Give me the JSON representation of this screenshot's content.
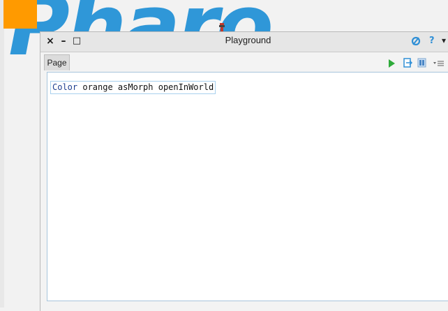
{
  "world": {
    "logo_text": "Pharo",
    "orange_morph_color": "#ff9a00",
    "logo_color": "#2f97d8"
  },
  "window": {
    "title": "Playground",
    "controls": {
      "close": "×",
      "minimize": "–",
      "maximize": "□"
    },
    "right_icons": {
      "refresh": "refresh-icon",
      "help": "?",
      "menu": "▾"
    }
  },
  "tabs": [
    {
      "label": "Page"
    }
  ],
  "toolbar": {
    "icons": [
      "do-it-icon",
      "inspect-icon",
      "bindings-icon",
      "menu-icon"
    ],
    "accent_color": "#2eaa3a"
  },
  "editor": {
    "code_class": "Color",
    "code_rest": " orange asMorph openInWorld"
  }
}
